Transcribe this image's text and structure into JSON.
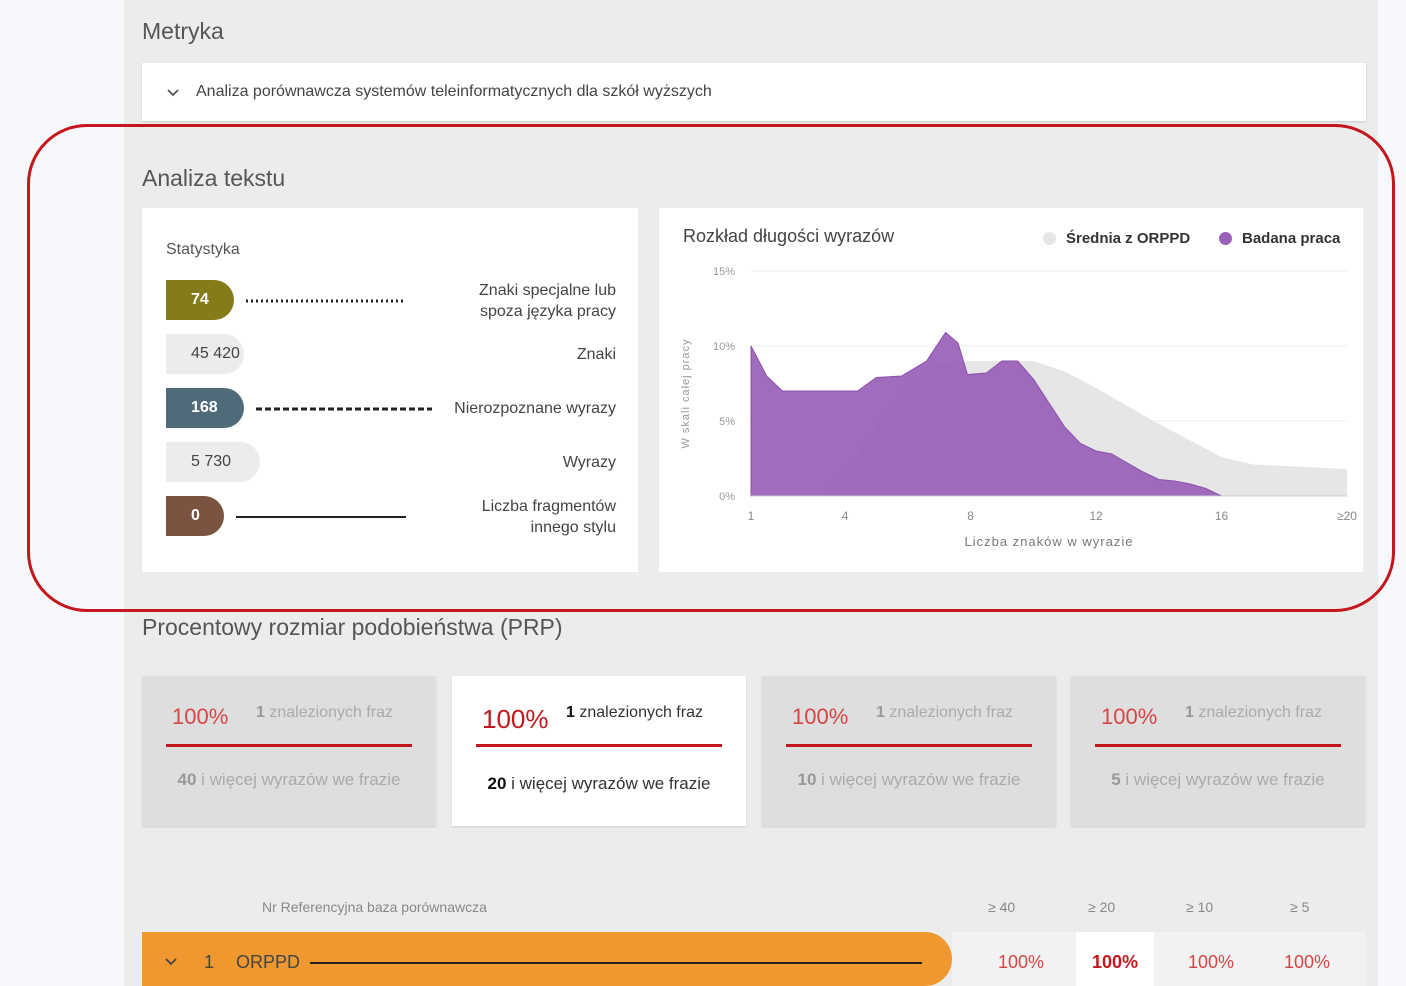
{
  "metryka": {
    "title": "Metryka",
    "item": "Analiza porównawcza systemów teleinformatycznych dla szkół wyższych"
  },
  "analiza": {
    "title": "Analiza tekstu",
    "stats_label": "Statystyka",
    "stats": [
      {
        "value": "74",
        "label_line1": "Znaki specjalne lub",
        "label_line2": "spoza języka pracy",
        "color": "#857c19"
      },
      {
        "value": "45 420",
        "label_line1": "Znaki",
        "label_line2": ""
      },
      {
        "value": "168",
        "label_line1": "Nierozpoznane wyrazy",
        "label_line2": "",
        "color": "#4f6b7a"
      },
      {
        "value": "5 730",
        "label_line1": "Wyrazy",
        "label_line2": ""
      },
      {
        "value": "0",
        "label_line1": "Liczba fragmentów",
        "label_line2": "innego stylu",
        "color": "#7a5440"
      }
    ]
  },
  "chart_data": {
    "type": "area",
    "title": "Rozkład długości wyrazów",
    "xlabel": "Liczba znaków w wyrazie",
    "ylabel": "W skali całej pracy",
    "x_ticks": [
      "1",
      "4",
      "8",
      "12",
      "16",
      "≥20"
    ],
    "y_ticks": [
      "0%",
      "5%",
      "10%",
      "15%"
    ],
    "ylim": [
      0,
      15
    ],
    "legend_placement": "top-right",
    "series": [
      {
        "name": "Średnia z ORPPD",
        "color": "#e6e6e6",
        "points": [
          [
            3.3,
            0
          ],
          [
            4.3,
            2.5
          ],
          [
            5.3,
            5.5
          ],
          [
            6,
            7.5
          ],
          [
            7,
            8.8
          ],
          [
            8,
            9
          ],
          [
            9,
            9
          ],
          [
            10,
            9
          ],
          [
            11,
            8.3
          ],
          [
            12,
            7.2
          ],
          [
            13,
            6
          ],
          [
            14,
            4.8
          ],
          [
            15,
            3.7
          ],
          [
            16,
            2.6
          ],
          [
            17,
            2.1
          ],
          [
            18,
            2
          ],
          [
            19,
            1.9
          ],
          [
            20,
            1.8
          ]
        ]
      },
      {
        "name": "Badana praca",
        "color": "#9a5fb8",
        "points": [
          [
            1,
            10
          ],
          [
            1.5,
            8
          ],
          [
            2,
            7
          ],
          [
            3,
            7
          ],
          [
            4,
            7
          ],
          [
            4.4,
            7
          ],
          [
            5,
            7.9
          ],
          [
            5.8,
            8
          ],
          [
            6.6,
            9
          ],
          [
            7.2,
            10.9
          ],
          [
            7.6,
            10.2
          ],
          [
            7.9,
            8.1
          ],
          [
            8.5,
            8.2
          ],
          [
            9,
            9
          ],
          [
            9.5,
            9
          ],
          [
            10,
            7.8
          ],
          [
            10.5,
            6.2
          ],
          [
            11,
            4.6
          ],
          [
            11.5,
            3.5
          ],
          [
            12,
            3
          ],
          [
            12.5,
            2.8
          ],
          [
            13,
            2.2
          ],
          [
            13.5,
            1.6
          ],
          [
            14,
            1.1
          ],
          [
            14.5,
            1
          ],
          [
            15,
            0.8
          ],
          [
            15.5,
            0.5
          ],
          [
            16,
            0
          ],
          [
            20,
            0
          ]
        ]
      }
    ]
  },
  "prp": {
    "title": "Procentowy rozmiar podobieństwa (PRP)",
    "cards": [
      {
        "pct": "100%",
        "found_num": "1",
        "found_text": "znalezionych fraz",
        "words_num": "40",
        "words_text": "i więcej wyrazów we frazie"
      },
      {
        "pct": "100%",
        "found_num": "1",
        "found_text": "znalezionych fraz",
        "words_num": "20",
        "words_text": "i więcej wyrazów we frazie"
      },
      {
        "pct": "100%",
        "found_num": "1",
        "found_text": "znalezionych fraz",
        "words_num": "10",
        "words_text": "i więcej wyrazów we frazie"
      },
      {
        "pct": "100%",
        "found_num": "1",
        "found_text": "znalezionych fraz",
        "words_num": "5",
        "words_text": "i więcej wyrazów we frazie"
      }
    ]
  },
  "table": {
    "header_base": "Nr Referencyjna baza porównawcza",
    "cols": [
      "≥ 40",
      "≥ 20",
      "≥ 10",
      "≥ 5"
    ],
    "row": {
      "num": "1",
      "name": "ORPPD",
      "values": [
        "100%",
        "100%",
        "100%",
        "100%"
      ]
    }
  },
  "colors": {
    "accent": "#c4161c",
    "orange": "#f0982f",
    "purple": "#9a5fb8"
  }
}
